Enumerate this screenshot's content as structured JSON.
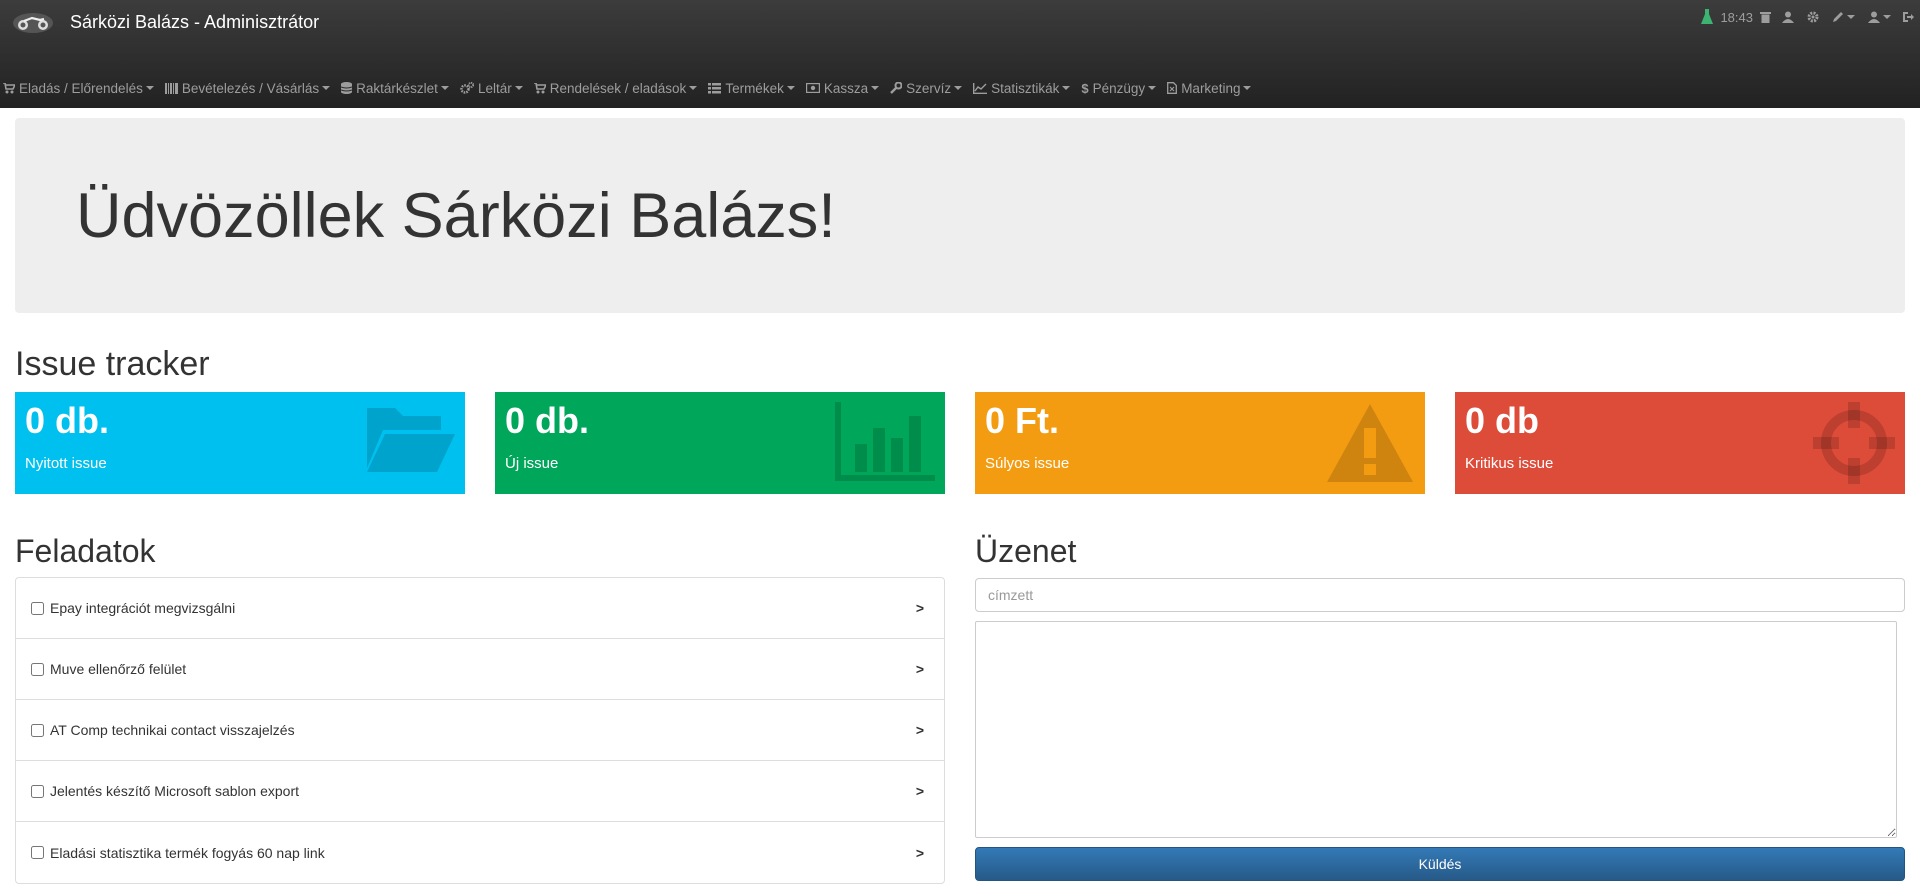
{
  "header": {
    "title": "Sárközi Balázs - Adminisztrátor",
    "logo_icon": "motorcycle-icon",
    "clock": "18:43",
    "status_color": "#3cb371",
    "icons": [
      "status-flask-icon",
      "trash-icon",
      "user-icon",
      "settings-icon",
      "edit-icon",
      "account-icon",
      "logout-icon"
    ]
  },
  "menu": {
    "items": [
      {
        "label": "Eladás / Előrendelés",
        "icon": "cart-icon"
      },
      {
        "label": "Bevételezés / Vásárlás",
        "icon": "barcode-icon"
      },
      {
        "label": "Raktárkészlet",
        "icon": "database-icon"
      },
      {
        "label": "Leltár",
        "icon": "cogs-icon"
      },
      {
        "label": "Rendelések / eladások",
        "icon": "cart-icon"
      },
      {
        "label": "Termékek",
        "icon": "list-icon"
      },
      {
        "label": "Kassza",
        "icon": "money-icon"
      },
      {
        "label": "Szervíz",
        "icon": "wrench-icon"
      },
      {
        "label": "Statisztikák",
        "icon": "line-chart-icon"
      },
      {
        "label": "Pénzügy",
        "icon": "dollar-icon"
      },
      {
        "label": "Marketing",
        "icon": "file-icon"
      }
    ]
  },
  "welcome": "Üdvözöllek Sárközi Balázs!",
  "issue_tracker": {
    "title": "Issue tracker",
    "boxes": [
      {
        "value": "0 db.",
        "label": "Nyitott issue",
        "color": "#00c0ef",
        "icon": "folder-open-icon"
      },
      {
        "value": "0 db.",
        "label": "Új issue",
        "color": "#00a65a",
        "icon": "bar-chart-icon"
      },
      {
        "value": "0 Ft.",
        "label": "Súlyos issue",
        "color": "#f39c12",
        "icon": "warning-icon"
      },
      {
        "value": "0 db",
        "label": "Kritikus issue",
        "color": "#dd4b39",
        "icon": "crosshairs-icon"
      }
    ]
  },
  "tasks": {
    "title": "Feladatok",
    "items": [
      {
        "label": "Epay integrációt megvizsgálni",
        "action": ">"
      },
      {
        "label": "Muve ellenőrző felület",
        "action": ">"
      },
      {
        "label": "AT Comp technikai contact visszajelzés",
        "action": ">"
      },
      {
        "label": "Jelentés készítő Microsoft sablon export",
        "action": ">"
      },
      {
        "label": "Eladási statisztika termék fogyás 60 nap link",
        "action": ">"
      }
    ]
  },
  "message": {
    "title": "Üzenet",
    "recipient_placeholder": "címzett",
    "send_label": "Küldés"
  }
}
